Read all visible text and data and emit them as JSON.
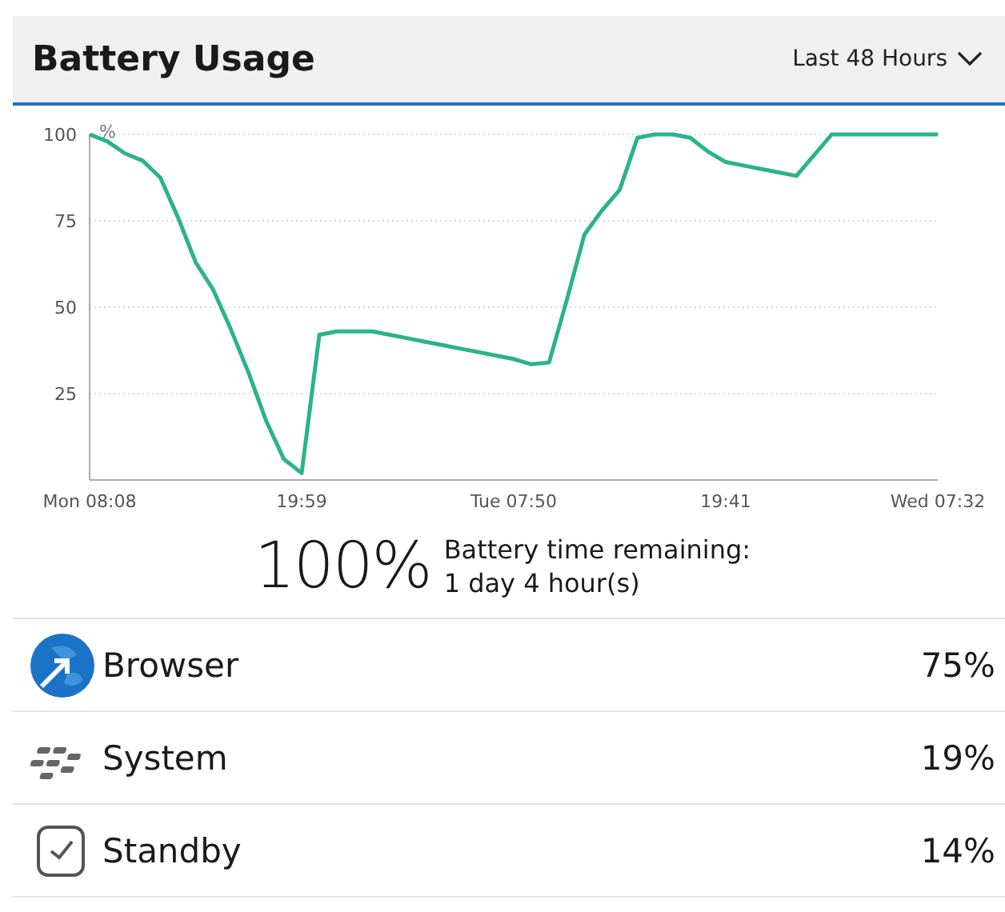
{
  "header": {
    "title": "Battery Usage",
    "range": "Last 48 Hours"
  },
  "chart_data": {
    "type": "line",
    "grid": true,
    "ylabel": "%",
    "ylim": [
      0,
      100
    ],
    "yticks": [
      25,
      50,
      75,
      100
    ],
    "categories": [
      "Mon 08:08",
      null,
      null,
      null,
      null,
      null,
      null,
      null,
      null,
      null,
      null,
      null,
      "19:59",
      null,
      null,
      null,
      null,
      null,
      null,
      null,
      null,
      null,
      null,
      null,
      "Tue 07:50",
      null,
      null,
      null,
      null,
      null,
      null,
      null,
      null,
      null,
      null,
      null,
      "19:41",
      null,
      null,
      null,
      null,
      null,
      null,
      null,
      null,
      null,
      null,
      null,
      "Wed 07:32"
    ],
    "series": [
      {
        "color": "#2bb38a",
        "values": [
          100,
          98,
          94.5,
          92.4,
          87.5,
          76,
          63,
          55,
          43.5,
          31,
          17,
          6,
          2,
          42,
          43,
          43,
          43,
          42,
          41,
          40,
          39,
          38,
          37,
          36,
          35,
          33.5,
          34,
          52,
          71,
          78,
          84,
          99,
          100,
          100,
          99,
          95,
          92,
          91,
          90,
          89,
          88,
          94,
          100,
          100,
          100,
          100,
          100,
          100,
          100
        ]
      }
    ]
  },
  "summary": {
    "percent": "100%",
    "label": "Battery time remaining:",
    "remaining": "1 day 4 hour(s)"
  },
  "apps": [
    {
      "kind": "browser",
      "name": "Browser",
      "share": "75%"
    },
    {
      "kind": "system",
      "name": "System",
      "share": "19%"
    },
    {
      "kind": "standby",
      "name": "Standby",
      "share": "14%"
    }
  ]
}
